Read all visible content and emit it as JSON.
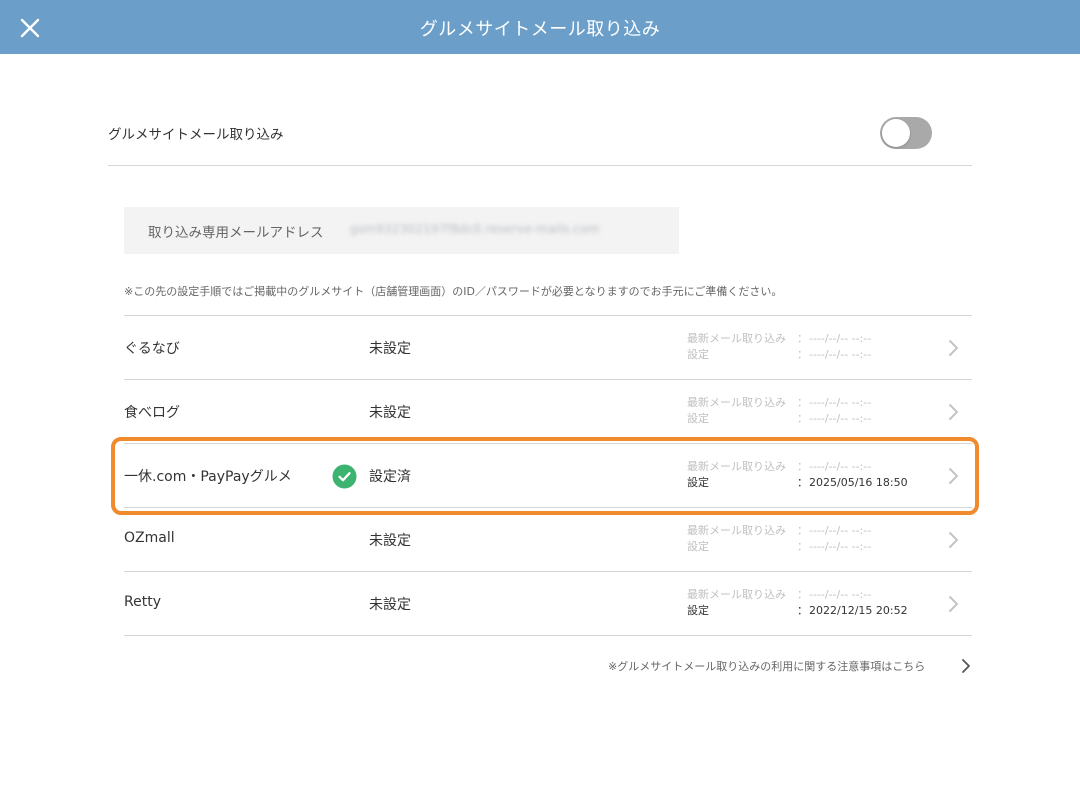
{
  "header": {
    "title": "グルメサイトメール取り込み",
    "close_icon": "close-icon"
  },
  "toggle_section": {
    "label": "グルメサイトメール取り込み",
    "enabled": false
  },
  "address": {
    "label": "取り込み専用メールアドレス",
    "value": "gsm932302197f8dc0.reserve-mails.com"
  },
  "note": "※この先の設定手順ではご掲載中のグルメサイト（店舗管理画面）のID／パスワードが必要となりますのでお手元にご準備ください。",
  "info_labels": {
    "latest": "最新メール取り込み",
    "setting": "設定",
    "colon": "："
  },
  "sites": [
    {
      "name": "ぐるなび",
      "status": "未設定",
      "configured": false,
      "latest": "----/--/-- --:--",
      "setting": "----/--/-- --:--"
    },
    {
      "name": "食べログ",
      "status": "未設定",
      "configured": false,
      "latest": "----/--/-- --:--",
      "setting": "----/--/-- --:--"
    },
    {
      "name": "一休.com・PayPayグルメ",
      "status": "設定済",
      "configured": true,
      "latest": "----/--/-- --:--",
      "setting": "2025/05/16 18:50"
    },
    {
      "name": "OZmall",
      "status": "未設定",
      "configured": false,
      "latest": "----/--/-- --:--",
      "setting": "----/--/-- --:--"
    },
    {
      "name": "Retty",
      "status": "未設定",
      "configured": false,
      "latest": "----/--/-- --:--",
      "setting": "2022/12/15 20:52"
    }
  ],
  "footer_link": "※グルメサイトメール取り込みの利用に関する注意事項はこちら",
  "colors": {
    "header_bg": "#6b9fc9",
    "highlight": "#f08a2c",
    "check": "#3cb371",
    "toggle_off": "#a9a9a9"
  }
}
